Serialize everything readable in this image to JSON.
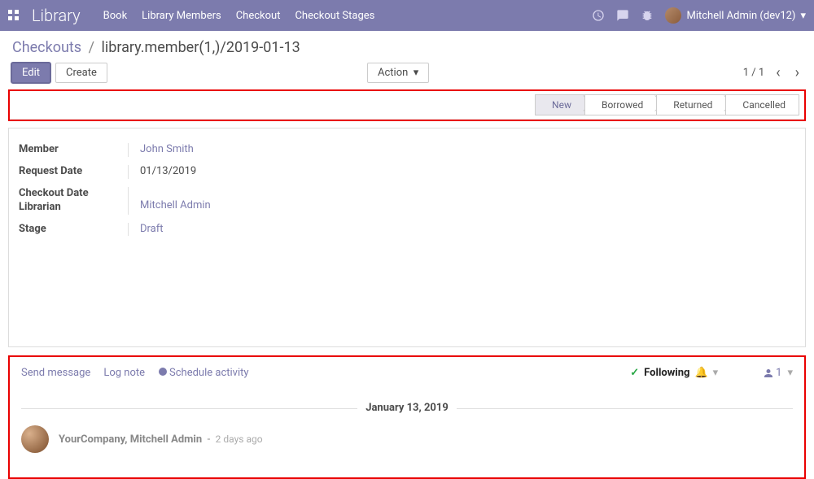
{
  "brand": "Library",
  "menu": {
    "book": "Book",
    "members": "Library Members",
    "checkout": "Checkout",
    "stages": "Checkout Stages"
  },
  "user": "Mitchell Admin (dev12)",
  "breadcrumb": {
    "root": "Checkouts",
    "current": "library.member(1,)/2019-01-13"
  },
  "buttons": {
    "edit": "Edit",
    "create": "Create",
    "action": "Action"
  },
  "pager": {
    "label": "1 / 1"
  },
  "stages": {
    "new": "New",
    "borrowed": "Borrowed",
    "returned": "Returned",
    "cancelled": "Cancelled"
  },
  "form": {
    "member_label": "Member",
    "member_value": "John Smith",
    "reqdate_label": "Request Date",
    "reqdate_value": "01/13/2019",
    "codate_label": "Checkout Date",
    "librarian_label": "Librarian",
    "librarian_value": "Mitchell Admin",
    "stage_label": "Stage",
    "stage_value": "Draft"
  },
  "chatter": {
    "send": "Send message",
    "log": "Log note",
    "schedule": "Schedule activity",
    "following": "Following",
    "followers_count": "1",
    "date_sep": "January 13, 2019",
    "author": "YourCompany, Mitchell Admin",
    "time": "2 days ago"
  }
}
